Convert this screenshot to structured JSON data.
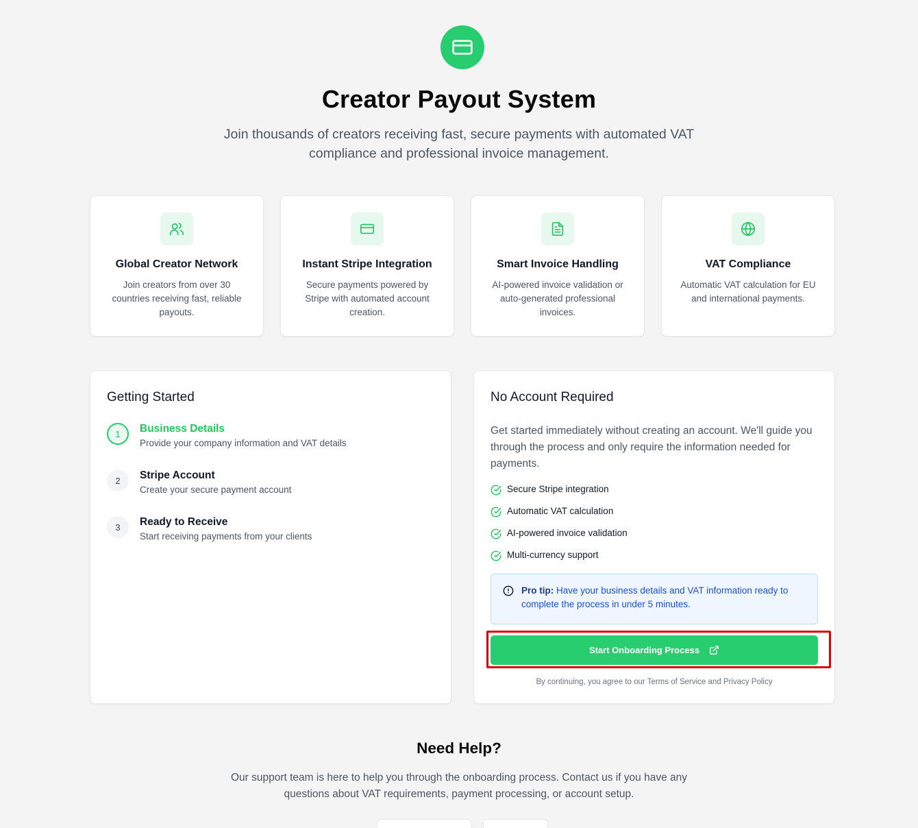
{
  "hero": {
    "icon": "credit-card-icon",
    "title": "Creator Payout System",
    "subtitle": "Join thousands of creators receiving fast, secure payments with automated VAT compliance and professional invoice management."
  },
  "features": [
    {
      "icon": "users-icon",
      "title": "Global Creator Network",
      "description": "Join creators from over 30 countries receiving fast, reliable payouts."
    },
    {
      "icon": "credit-card-icon",
      "title": "Instant Stripe Integration",
      "description": "Secure payments powered by Stripe with automated account creation."
    },
    {
      "icon": "file-text-icon",
      "title": "Smart Invoice Handling",
      "description": "AI-powered invoice validation or auto-generated professional invoices."
    },
    {
      "icon": "globe-icon",
      "title": "VAT Compliance",
      "description": "Automatic VAT calculation for EU and international payments."
    }
  ],
  "getting_started": {
    "title": "Getting Started",
    "steps": [
      {
        "number": "1",
        "title": "Business Details",
        "description": "Provide your company information and VAT details",
        "active": true
      },
      {
        "number": "2",
        "title": "Stripe Account",
        "description": "Create your secure payment account",
        "active": false
      },
      {
        "number": "3",
        "title": "Ready to Receive",
        "description": "Start receiving payments from your clients",
        "active": false
      }
    ]
  },
  "no_account": {
    "title": "No Account Required",
    "description": "Get started immediately without creating an account. We'll guide you through the process and only require the information needed for payments.",
    "checks": [
      "Secure Stripe integration",
      "Automatic VAT calculation",
      "AI-powered invoice validation",
      "Multi-currency support"
    ],
    "tip_label": "Pro tip:",
    "tip_text": "Have your business details and VAT information ready to complete the process in under 5 minutes.",
    "button_label": "Start Onboarding Process",
    "button_icon": "external-link-icon",
    "terms": "By continuing, you agree to our Terms of Service and Privacy Policy"
  },
  "help": {
    "title": "Need Help?",
    "subtitle": "Our support team is here to help you through the onboarding process. Contact us if you have any questions about VAT requirements, payment processing, or account setup."
  },
  "colors": {
    "accent": "#27cd6f",
    "tip_bg": "#eff6ff",
    "tip_text": "#1d4ed8",
    "highlight": "#e00000"
  }
}
